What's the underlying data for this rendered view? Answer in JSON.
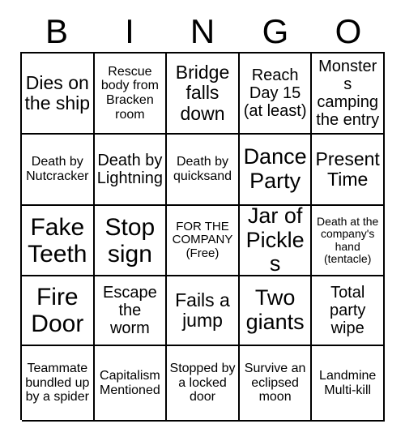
{
  "card": {
    "header_letters": [
      "B",
      "I",
      "N",
      "G",
      "O"
    ],
    "rows": [
      [
        {
          "text": "Dies on the ship",
          "size": "l"
        },
        {
          "text": "Rescue body from Bracken room",
          "size": "s"
        },
        {
          "text": "Bridge falls down",
          "size": "l"
        },
        {
          "text": "Reach Day 15 (at least)",
          "size": "m"
        },
        {
          "text": "Monsters camping the entry",
          "size": "m"
        }
      ],
      [
        {
          "text": "Death by Nutcracker",
          "size": "s"
        },
        {
          "text": "Death by Lightning",
          "size": "m"
        },
        {
          "text": "Death by quicksand",
          "size": "s"
        },
        {
          "text": "Dance Party",
          "size": "xl"
        },
        {
          "text": "Present Time",
          "size": "l"
        }
      ],
      [
        {
          "text": "Fake Teeth",
          "size": "xxl"
        },
        {
          "text": "Stop sign",
          "size": "xxl"
        },
        {
          "text": "FOR THE COMPANY (Free)",
          "size": "free"
        },
        {
          "text": "Jar of Pickles",
          "size": "xl"
        },
        {
          "text": "Death at the company's hand (tentacle)",
          "size": "xs"
        }
      ],
      [
        {
          "text": "Fire Door",
          "size": "xxl"
        },
        {
          "text": "Escape the worm",
          "size": "m"
        },
        {
          "text": "Fails a jump",
          "size": "l"
        },
        {
          "text": "Two giants",
          "size": "xl"
        },
        {
          "text": "Total party wipe",
          "size": "m"
        }
      ],
      [
        {
          "text": "Teammate bundled up by a spider",
          "size": "s"
        },
        {
          "text": "Capitalism Mentioned",
          "size": "s"
        },
        {
          "text": "Stopped by a locked door",
          "size": "s"
        },
        {
          "text": "Survive an eclipsed moon",
          "size": "s"
        },
        {
          "text": "Landmine Multi-kill",
          "size": "s"
        }
      ]
    ]
  },
  "colors": {
    "background": "#ffffff",
    "border": "#000000",
    "text": "#000000"
  }
}
